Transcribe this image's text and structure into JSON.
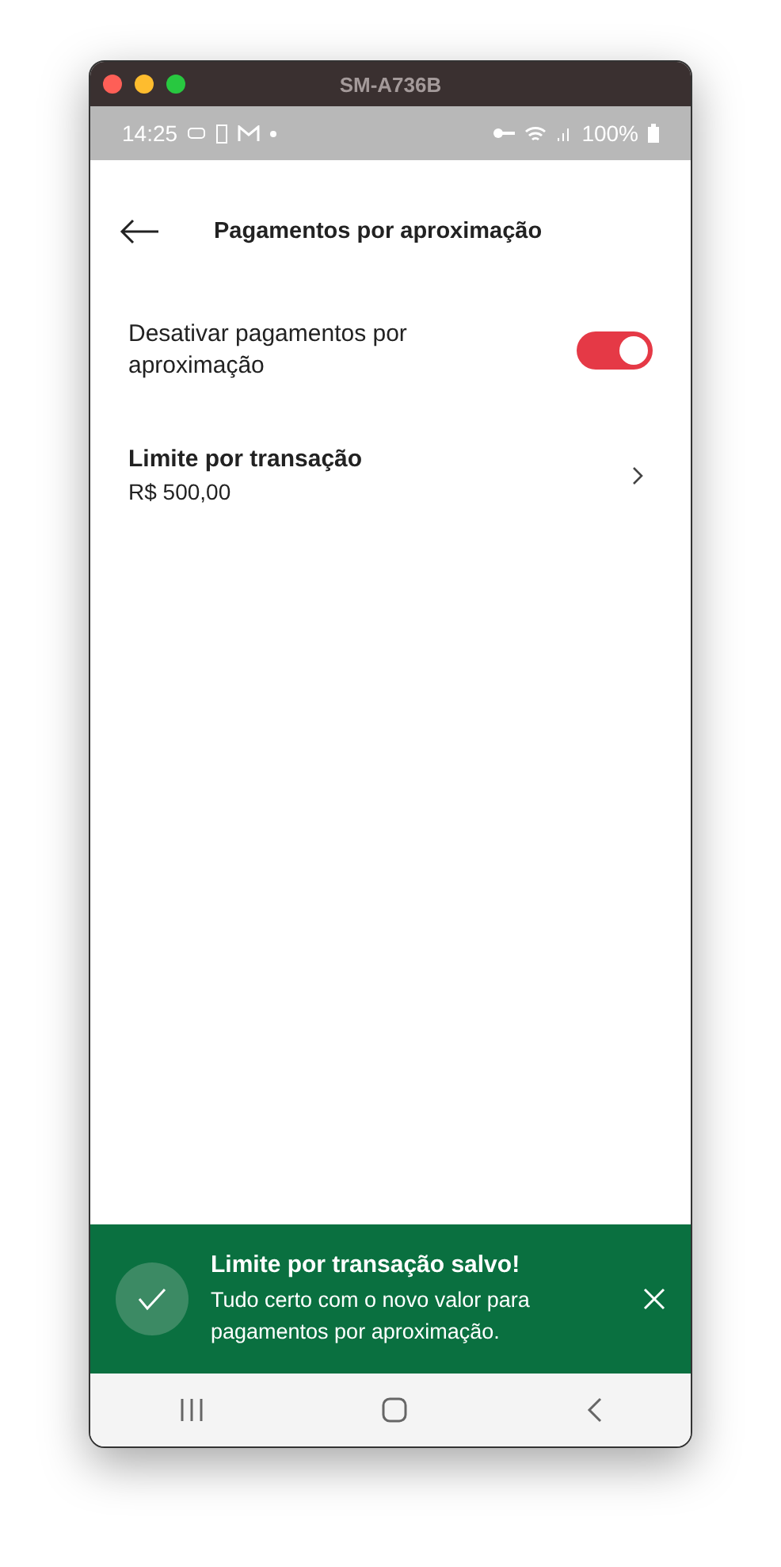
{
  "window": {
    "title": "SM-A736B"
  },
  "status_bar": {
    "time": "14:25",
    "battery": "100%"
  },
  "header": {
    "title": "Pagamentos por aproximação"
  },
  "settings": [
    {
      "kind": "toggle",
      "label": "Desativar pagamentos por aproximação",
      "on": true
    },
    {
      "kind": "link",
      "label": "Limite por transação",
      "value": "R$ 500,00"
    }
  ],
  "toast": {
    "title": "Limite por transação salvo!",
    "message": "Tudo certo com o novo valor para pagamentos por aproximação."
  }
}
